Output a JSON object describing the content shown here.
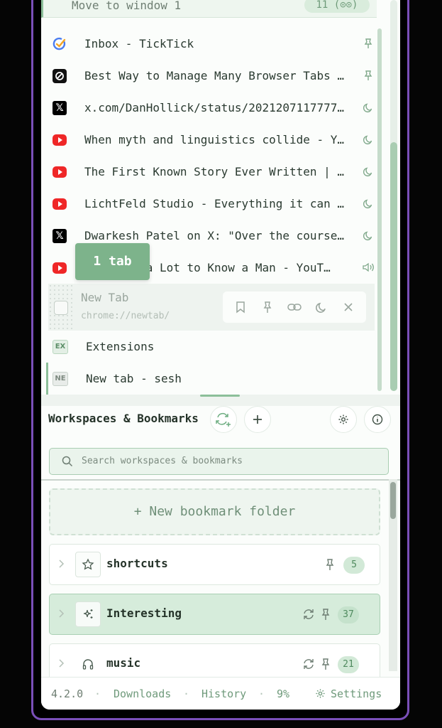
{
  "window_header": {
    "label": "Move to window 1",
    "count": "11 (⊙⊙)"
  },
  "tabs": [
    {
      "title": "Inbox - TickTick",
      "icon": "ticktick-icon",
      "status": "pin"
    },
    {
      "title": "Best Way to Manage Many Browser Tabs …",
      "icon": "dark-logo-icon",
      "status": "pin"
    },
    {
      "title": "x.com/DanHollick/status/2021207117777…",
      "icon": "x-icon",
      "status": "sleep"
    },
    {
      "title": "When myth and linguistics collide - Y…",
      "icon": "youtube-icon",
      "status": "sleep"
    },
    {
      "title": "The First Known Story Ever Written | …",
      "icon": "youtube-icon",
      "status": "sleep"
    },
    {
      "title": "LichtFeld Studio - Everything it can …",
      "icon": "youtube-icon",
      "status": "sleep"
    },
    {
      "title": "Dwarkesh Patel on X: \"Over the course…",
      "icon": "x-icon",
      "status": "sleep"
    },
    {
      "title": "It Takes a Lot to Know a Man - YouT…",
      "icon": "youtube-icon",
      "status": "audio"
    }
  ],
  "selected_tab": {
    "title": "New Tab",
    "url": "chrome://newtab/"
  },
  "extra_tabs": [
    {
      "title": "Extensions",
      "badge": "EX"
    },
    {
      "title": "New tab - sesh",
      "badge": "NE"
    }
  ],
  "tooltip": "1 tab",
  "workspaces": {
    "title": "Workspaces & Bookmarks",
    "search_placeholder": "Search workspaces & bookmarks",
    "new_folder": "+ New bookmark folder",
    "folders": [
      {
        "name": "shortcuts",
        "count": "5",
        "icon": "star-icon"
      },
      {
        "name": "Interesting",
        "count": "37",
        "icon": "sparkle-icon"
      },
      {
        "name": "music",
        "count": "21",
        "icon": "headphones-icon"
      }
    ]
  },
  "footer": {
    "version": "4.2.0",
    "downloads": "Downloads",
    "history": "History",
    "percent": "9%",
    "settings": "Settings"
  }
}
